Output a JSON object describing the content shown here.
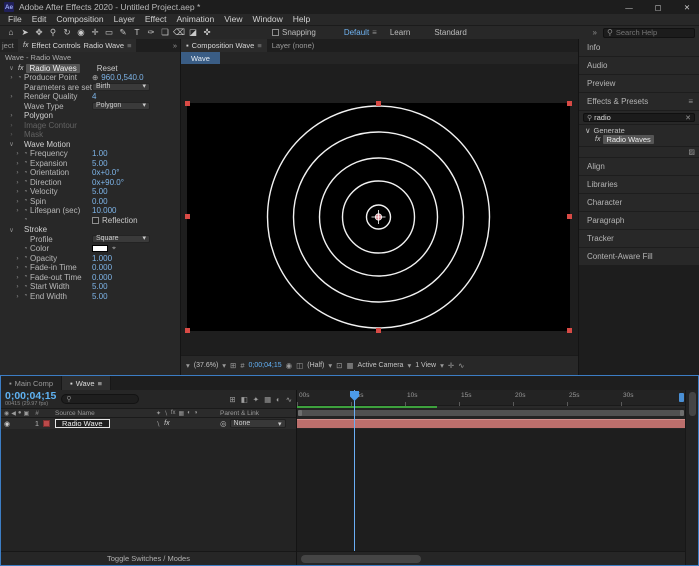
{
  "icons": {
    "menu": "≡",
    "chev": "▾",
    "chevrons": "»",
    "search": "⚲",
    "close_small": "✕",
    "grid": "⊞",
    "mask": "#",
    "snapshot": "◉",
    "channels": "◫",
    "roi": "⊡",
    "transparency": "▦",
    "pixel_aspect": "✛",
    "crosshair": "⊕",
    "stopwatch": "◔",
    "pickwhip": "◎",
    "eyedropper": "⌖",
    "fx": "fx",
    "eye": "◉",
    "panel_corner": "▨",
    "panel": "▪",
    "arrow_open": "∨",
    "graph": "∿"
  },
  "window": {
    "logo": "Ae",
    "title": "Adobe After Effects 2020 - Untitled Project.aep *",
    "minimize": "—",
    "maximize": "▢",
    "close": "✕"
  },
  "menu": {
    "items": [
      "File",
      "Edit",
      "Composition",
      "Layer",
      "Effect",
      "Animation",
      "View",
      "Window",
      "Help"
    ]
  },
  "toolbar": {
    "tools": [
      {
        "name": "home-icon",
        "glyph": "⌂"
      },
      {
        "name": "selection-tool-icon",
        "glyph": "➤"
      },
      {
        "name": "hand-tool-icon",
        "glyph": "✥"
      },
      {
        "name": "zoom-tool-icon",
        "glyph": "⚲"
      },
      {
        "name": "orbit-camera-tool-icon",
        "glyph": "↻"
      },
      {
        "name": "camera-tool-icon",
        "glyph": "◉"
      },
      {
        "name": "pan-behind-tool-icon",
        "glyph": "✛"
      },
      {
        "name": "shape-tool-icon",
        "glyph": "▭"
      },
      {
        "name": "pen-tool-icon",
        "glyph": "✎"
      },
      {
        "name": "type-tool-icon",
        "glyph": "T"
      },
      {
        "name": "brush-tool-icon",
        "glyph": "✑"
      },
      {
        "name": "clone-stamp-tool-icon",
        "glyph": "❏"
      },
      {
        "name": "eraser-tool-icon",
        "glyph": "⌫"
      },
      {
        "name": "roto-brush-tool-icon",
        "glyph": "◪"
      },
      {
        "name": "puppet-pin-tool-icon",
        "glyph": "✜"
      }
    ],
    "snapping_label": "Snapping",
    "workspace_default": "Default",
    "learn": "Learn",
    "standard": "Standard",
    "search_placeholder": "Search Help"
  },
  "effect_controls": {
    "project_tab": "ject",
    "tab_label": "Effect Controls",
    "tab_target": "Radio Wave",
    "caption": "Wave - Radio Wave",
    "effect_name": "Radio Waves",
    "reset_label": "Reset",
    "rows": [
      {
        "arrow": "›",
        "stopwatch": true,
        "label": "Producer Point",
        "type": "point",
        "value": "960.0,540.0"
      },
      {
        "label": "Parameters are set at",
        "type": "dropdown",
        "value": "Birth"
      },
      {
        "arrow": "›",
        "label": "Render Quality",
        "type": "value",
        "value": "4"
      },
      {
        "label": "Wave Type",
        "type": "dropdown",
        "value": "Polygon"
      },
      {
        "arrow": "›",
        "label": "Polygon",
        "type": "group"
      },
      {
        "arrow": "›",
        "label": "Image Contour",
        "type": "group",
        "grayed": true
      },
      {
        "arrow": "›",
        "label": "Mask",
        "type": "group",
        "grayed": true
      },
      {
        "arrow": "∨",
        "label": "Wave Motion",
        "type": "group"
      },
      {
        "arrow": "›",
        "stopwatch": true,
        "indent": true,
        "label": "Frequency",
        "type": "value",
        "value": "1.00"
      },
      {
        "arrow": "›",
        "stopwatch": true,
        "indent": true,
        "label": "Expansion",
        "type": "value",
        "value": "5.00"
      },
      {
        "arrow": "›",
        "stopwatch": true,
        "indent": true,
        "label": "Orientation",
        "type": "value",
        "value": "0x+0.0°"
      },
      {
        "arrow": "›",
        "stopwatch": true,
        "indent": true,
        "label": "Direction",
        "type": "value",
        "value": "0x+90.0°"
      },
      {
        "arrow": "›",
        "stopwatch": true,
        "indent": true,
        "label": "Velocity",
        "type": "value",
        "value": "5.00"
      },
      {
        "arrow": "›",
        "stopwatch": true,
        "indent": true,
        "label": "Spin",
        "type": "value",
        "value": "0.00"
      },
      {
        "arrow": "›",
        "stopwatch": true,
        "indent": true,
        "label": "Lifespan (sec)",
        "type": "value",
        "value": "10.000"
      },
      {
        "stopwatch": true,
        "indent": true,
        "label": "Reflection",
        "type": "checkbox"
      },
      {
        "arrow": "∨",
        "label": "Stroke",
        "type": "group"
      },
      {
        "indent": true,
        "label": "Profile",
        "type": "dropdown",
        "value": "Square"
      },
      {
        "stopwatch": true,
        "indent": true,
        "label": "Color",
        "type": "swatch"
      },
      {
        "arrow": "›",
        "stopwatch": true,
        "indent": true,
        "label": "Opacity",
        "type": "value",
        "value": "1.000"
      },
      {
        "arrow": "›",
        "stopwatch": true,
        "indent": true,
        "label": "Fade-in Time",
        "type": "value",
        "value": "0.000"
      },
      {
        "arrow": "›",
        "stopwatch": true,
        "indent": true,
        "label": "Fade-out Time",
        "type": "value",
        "value": "0.000"
      },
      {
        "arrow": "›",
        "stopwatch": true,
        "indent": true,
        "label": "Start Width",
        "type": "value",
        "value": "5.00"
      },
      {
        "arrow": "›",
        "stopwatch": true,
        "indent": true,
        "label": "End Width",
        "type": "value",
        "value": "5.00"
      }
    ]
  },
  "viewer": {
    "tab_composition": "Composition Wave",
    "tab_layer": "Layer (none)",
    "comp_tab": "Wave",
    "status": {
      "zoom": "(37.6%)",
      "timecode": "0;00;04;15",
      "resolution": "(Half)",
      "camera": "Active Camera",
      "view_layout": "1 View"
    }
  },
  "right_panels": {
    "upper": [
      {
        "name": "panel-info",
        "label": "Info"
      },
      {
        "name": "panel-audio",
        "label": "Audio"
      },
      {
        "name": "panel-preview",
        "label": "Preview"
      }
    ],
    "effects_presets": {
      "label": "Effects & Presets",
      "search_value": "radio",
      "group_label": "Generate",
      "item_label": "Radio Waves"
    },
    "lower": [
      {
        "name": "panel-align",
        "label": "Align"
      },
      {
        "name": "panel-libraries",
        "label": "Libraries"
      },
      {
        "name": "panel-character",
        "label": "Character"
      },
      {
        "name": "panel-paragraph",
        "label": "Paragraph"
      },
      {
        "name": "panel-tracker",
        "label": "Tracker"
      },
      {
        "name": "panel-content-aware-fill",
        "label": "Content-Aware Fill"
      }
    ]
  },
  "timeline": {
    "tab_main": "Main Comp",
    "tab_active": "Wave",
    "timecode": "0;00;04;15",
    "frame_info": "00415 (29.97 fps)",
    "columns": {
      "number": "#",
      "source_name": "Source Name",
      "parent_link": "Parent & Link"
    },
    "column_icons": [
      {
        "name": "eye-icon",
        "glyph": "◉"
      },
      {
        "name": "audio-icon",
        "glyph": "◀"
      },
      {
        "name": "solo-icon",
        "glyph": "●"
      },
      {
        "name": "lock-icon",
        "glyph": "▣"
      }
    ],
    "switch_icons": [
      {
        "name": "shy-icon",
        "glyph": "✦"
      },
      {
        "name": "quality-icon",
        "glyph": "∖"
      },
      {
        "name": "effects-icon",
        "glyph": "fx"
      },
      {
        "name": "frame-blend-icon",
        "glyph": "▦"
      },
      {
        "name": "motion-blur-icon",
        "glyph": "◐"
      },
      {
        "name": "3d-icon",
        "glyph": "◑"
      }
    ],
    "panel_icons": [
      {
        "name": "mini-flowchart-icon",
        "glyph": "⊞"
      },
      {
        "name": "draft-3d-icon",
        "glyph": "◧"
      },
      {
        "name": "hide-shy-layers-icon",
        "glyph": "✦"
      },
      {
        "name": "frame-blending-icon",
        "glyph": "▦"
      },
      {
        "name": "motion-blur-icon",
        "glyph": "◐"
      },
      {
        "name": "graph-editor-icon",
        "glyph": "∿"
      }
    ],
    "layer": {
      "index": "1",
      "name": "Radio Wave",
      "parent_value": "None"
    },
    "ruler_labels": [
      "00s",
      "05s",
      "10s",
      "15s",
      "20s",
      "25s",
      "30s"
    ],
    "footer_label": "Toggle Switches / Modes"
  }
}
